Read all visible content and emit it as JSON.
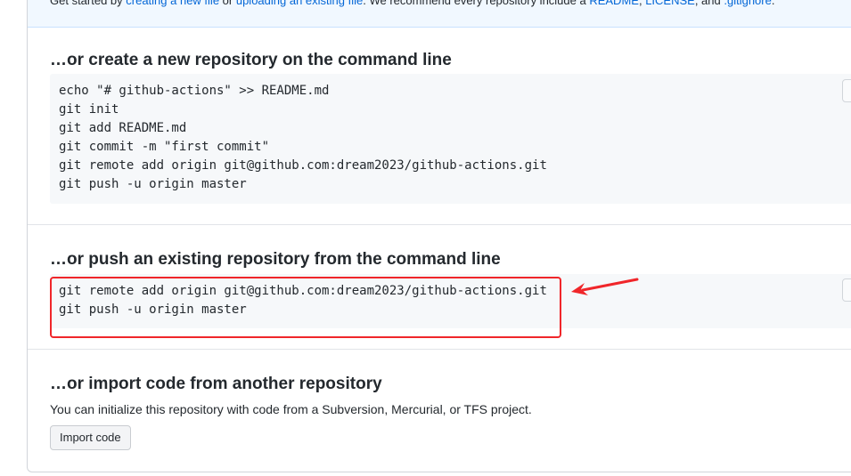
{
  "quick_setup": {
    "prefix": "Get started by ",
    "link_create": "creating a new file",
    "middle": " or ",
    "link_upload": "uploading an existing file",
    "recommend": ". We recommend every repository include a ",
    "link_readme": "README",
    "sep1": ", ",
    "link_license": "LICENSE",
    "sep2": ", and ",
    "link_gitignore": ".gitignore",
    "suffix": "."
  },
  "sections": {
    "new_repo": {
      "title": "…or create a new repository on the command line",
      "lines": [
        "echo \"# github-actions\" >> README.md",
        "git init",
        "git add README.md",
        "git commit -m \"first commit\"",
        "git remote add origin git@github.com:dream2023/github-actions.git",
        "git push -u origin master"
      ]
    },
    "push_existing": {
      "title": "…or push an existing repository from the command line",
      "lines": [
        "git remote add origin git@github.com:dream2023/github-actions.git",
        "git push -u origin master"
      ]
    },
    "import_code": {
      "title": "…or import code from another repository",
      "description": "You can initialize this repository with code from a Subversion, Mercurial, or TFS project.",
      "button_label": "Import code"
    }
  },
  "icons": {
    "copy": "clipboard-icon",
    "annotation_arrow": "red-arrow-icon"
  },
  "colors": {
    "link": "#0366d6",
    "code_background": "#f6f8fa",
    "banner_background": "#f1f8ff",
    "annotation": "#f0262a"
  }
}
